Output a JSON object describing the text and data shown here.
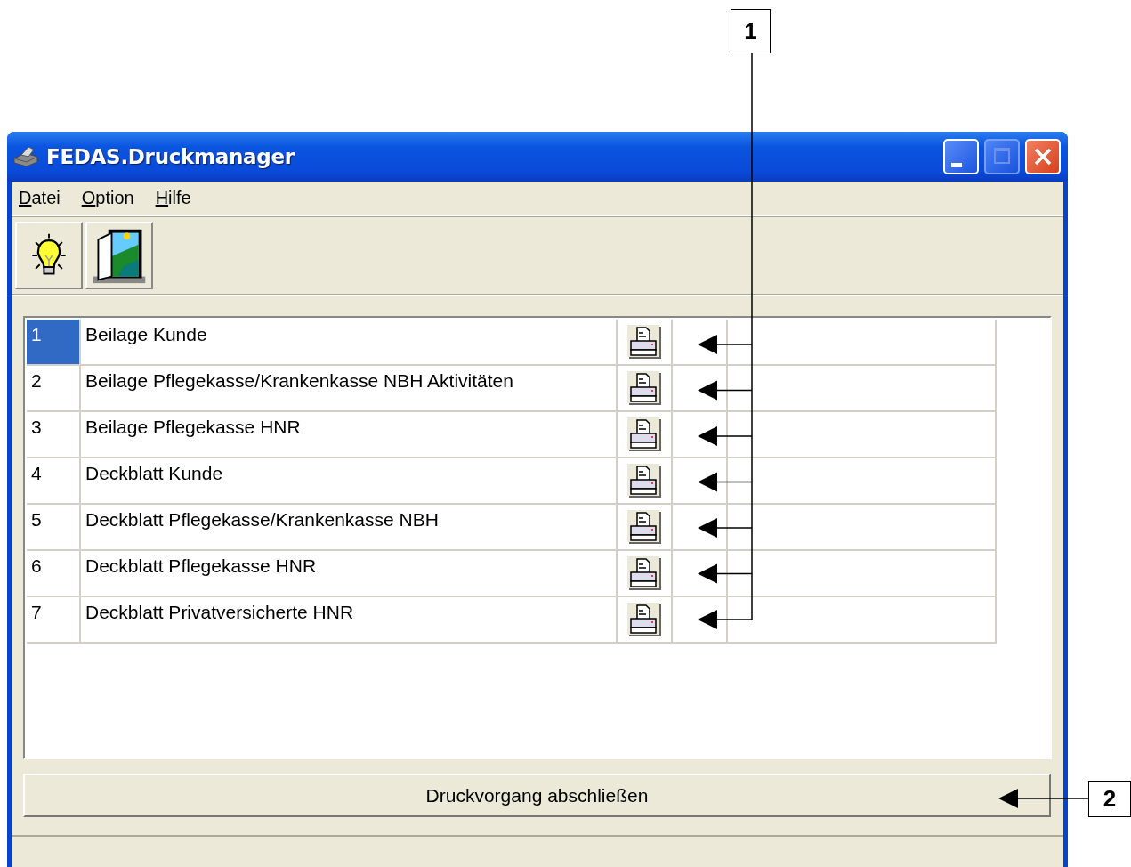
{
  "window": {
    "title": "FEDAS.Druckmanager"
  },
  "menu": [
    {
      "label": "Datei"
    },
    {
      "label": "Option"
    },
    {
      "label": "Hilfe"
    }
  ],
  "rows": [
    {
      "number": "1",
      "label": "Beilage Kunde",
      "selected": true
    },
    {
      "number": "2",
      "label": "Beilage Pflegekasse/Krankenkasse NBH Aktivitäten",
      "selected": false
    },
    {
      "number": "3",
      "label": "Beilage Pflegekasse HNR",
      "selected": false
    },
    {
      "number": "4",
      "label": "Deckblatt Kunde",
      "selected": false
    },
    {
      "number": "5",
      "label": "Deckblatt Pflegekasse/Krankenkasse NBH",
      "selected": false
    },
    {
      "number": "6",
      "label": "Deckblatt Pflegekasse HNR",
      "selected": false
    },
    {
      "number": "7",
      "label": "Deckblatt Privatversicherte HNR",
      "selected": false
    }
  ],
  "finish_button": {
    "label": "Druckvorgang abschließen"
  },
  "callouts": [
    {
      "label": "1"
    },
    {
      "label": "2"
    }
  ]
}
